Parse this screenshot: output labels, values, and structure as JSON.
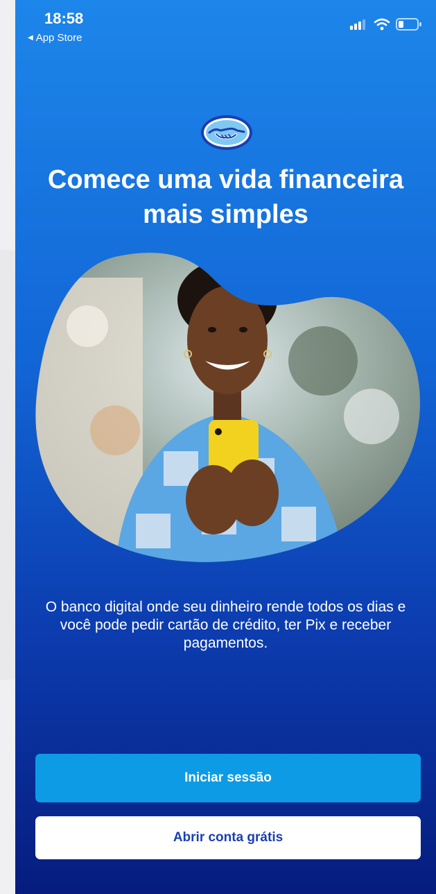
{
  "status_bar": {
    "time": "18:58",
    "back_label": "App Store",
    "icons": [
      "signal-icon",
      "wifi-icon",
      "battery-icon"
    ]
  },
  "brand": {
    "logo": "handshake-logo"
  },
  "hero": {
    "title": "Comece uma vida financeira mais simples",
    "image": "woman-smiling-holding-yellow-phone"
  },
  "description": "O banco digital onde seu dinheiro rende todos os dias e você pode pedir cartão de crédito, ter Pix e receber pagamentos.",
  "actions": {
    "login_label": "Iniciar sessão",
    "signup_label": "Abrir conta grátis"
  },
  "colors": {
    "background_top": "#1d86ea",
    "background_bottom": "#061c7e",
    "primary_button": "#0d9be6",
    "secondary_text": "#1a3fb0"
  }
}
